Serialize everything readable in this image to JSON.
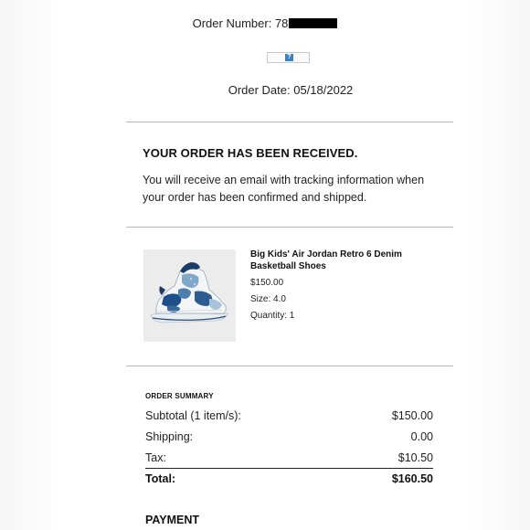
{
  "header": {
    "order_number_label": "Order Number: 78",
    "order_date": "Order Date: 05/18/2022"
  },
  "confirmation": {
    "title": "YOUR ORDER HAS BEEN RECEIVED.",
    "message": "You will receive an email with tracking information when your order has been confirmed and shipped."
  },
  "product": {
    "name": "Big Kids' Air Jordan Retro 6 Denim Basketball Shoes",
    "price": "$150.00",
    "size": "Size: 4.0",
    "quantity": "Quantity: 1"
  },
  "summary": {
    "heading": "ORDER SUMMARY",
    "rows": [
      {
        "label": "Subtotal (1 item/s):",
        "value": "$150.00"
      },
      {
        "label": "Shipping:",
        "value": "0.00"
      },
      {
        "label": "Tax:",
        "value": "$10.50"
      }
    ],
    "total_label": "Total:",
    "total_value": "$160.50"
  },
  "payment": {
    "heading": "PAYMENT"
  },
  "colors": {
    "divider": "#b9b9b9",
    "redaction": "#000000",
    "shoe_blue": "#1f4f8a",
    "shoe_denim": "#7fa8c9",
    "image_background": "#ececec"
  },
  "icons": {
    "broken_image": "broken-image-icon",
    "product_photo": "sneaker-image"
  }
}
